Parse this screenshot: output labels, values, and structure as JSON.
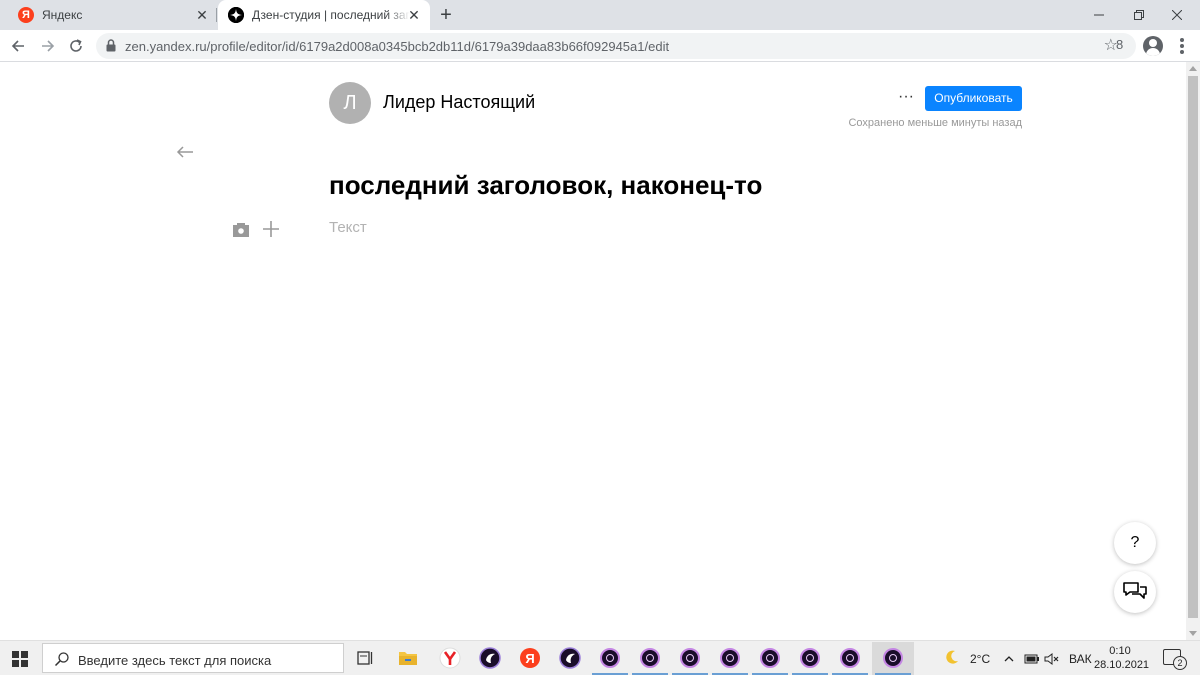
{
  "browser": {
    "tabs": [
      {
        "title": "Яндекс",
        "favicon_letter": "Я",
        "active": false
      },
      {
        "title": "Дзен-студия | последний заголовок, наконец-то",
        "active": true
      }
    ],
    "url": "zen.yandex.ru/profile/editor/id/6179a2d008a0345bcb2db11d/6179a39daa83b66f092945a1/edit",
    "extension_count": "8"
  },
  "editor": {
    "author_initial": "Л",
    "author_name": "Лидер Настоящий",
    "publish_label": "Опубликовать",
    "save_status": "Сохранено меньше минуты назад",
    "article_title": "последний заголовок, наконец-то",
    "text_placeholder": "Текст",
    "help_label": "?",
    "more_label": "···"
  },
  "taskbar": {
    "search_placeholder": "Введите здесь текст для поиска",
    "weather_temp": "2°C",
    "language": "ВАК",
    "time": "0:10",
    "date": "28.10.2021",
    "notification_count": "2"
  },
  "colors": {
    "publish_button": "#0a84ff",
    "avatar_bg": "#b1b1b1",
    "yandex_red": "#fc3f1d"
  }
}
